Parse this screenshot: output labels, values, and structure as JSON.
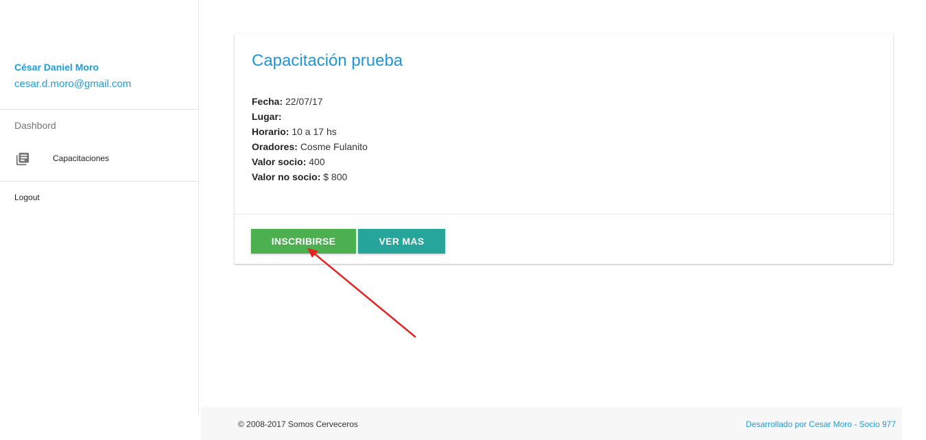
{
  "user": {
    "name": "César Daniel Moro",
    "email": "cesar.d.moro@gmail.com"
  },
  "sidebar": {
    "section_label": "Dashbord",
    "items": [
      {
        "label": "Capacitaciones",
        "icon": "library-books-icon"
      }
    ],
    "logout_label": "Logout"
  },
  "card": {
    "title": "Capacitación prueba",
    "details": [
      {
        "label": "Fecha:",
        "value": "22/07/17"
      },
      {
        "label": "Lugar:",
        "value": ""
      },
      {
        "label": "Horario:",
        "value": "10 a 17 hs"
      },
      {
        "label": "Oradores:",
        "value": "Cosme Fulanito"
      },
      {
        "label": "Valor socio:",
        "value": "400"
      },
      {
        "label": "Valor no socio:",
        "value": "$ 800"
      }
    ],
    "actions": {
      "inscribe_label": "INSCRIBIRSE",
      "more_label": "VER MAS"
    }
  },
  "footer": {
    "copyright": "© 2008-2017 Somos Cerveceros",
    "developer": "Desarrollado por Cesar Moro - Socio 977"
  },
  "colors": {
    "accent": "#1e9cd7",
    "inscribe_button": "#4caf50",
    "more_button": "#26a69a",
    "annotation_arrow": "#e52222"
  }
}
